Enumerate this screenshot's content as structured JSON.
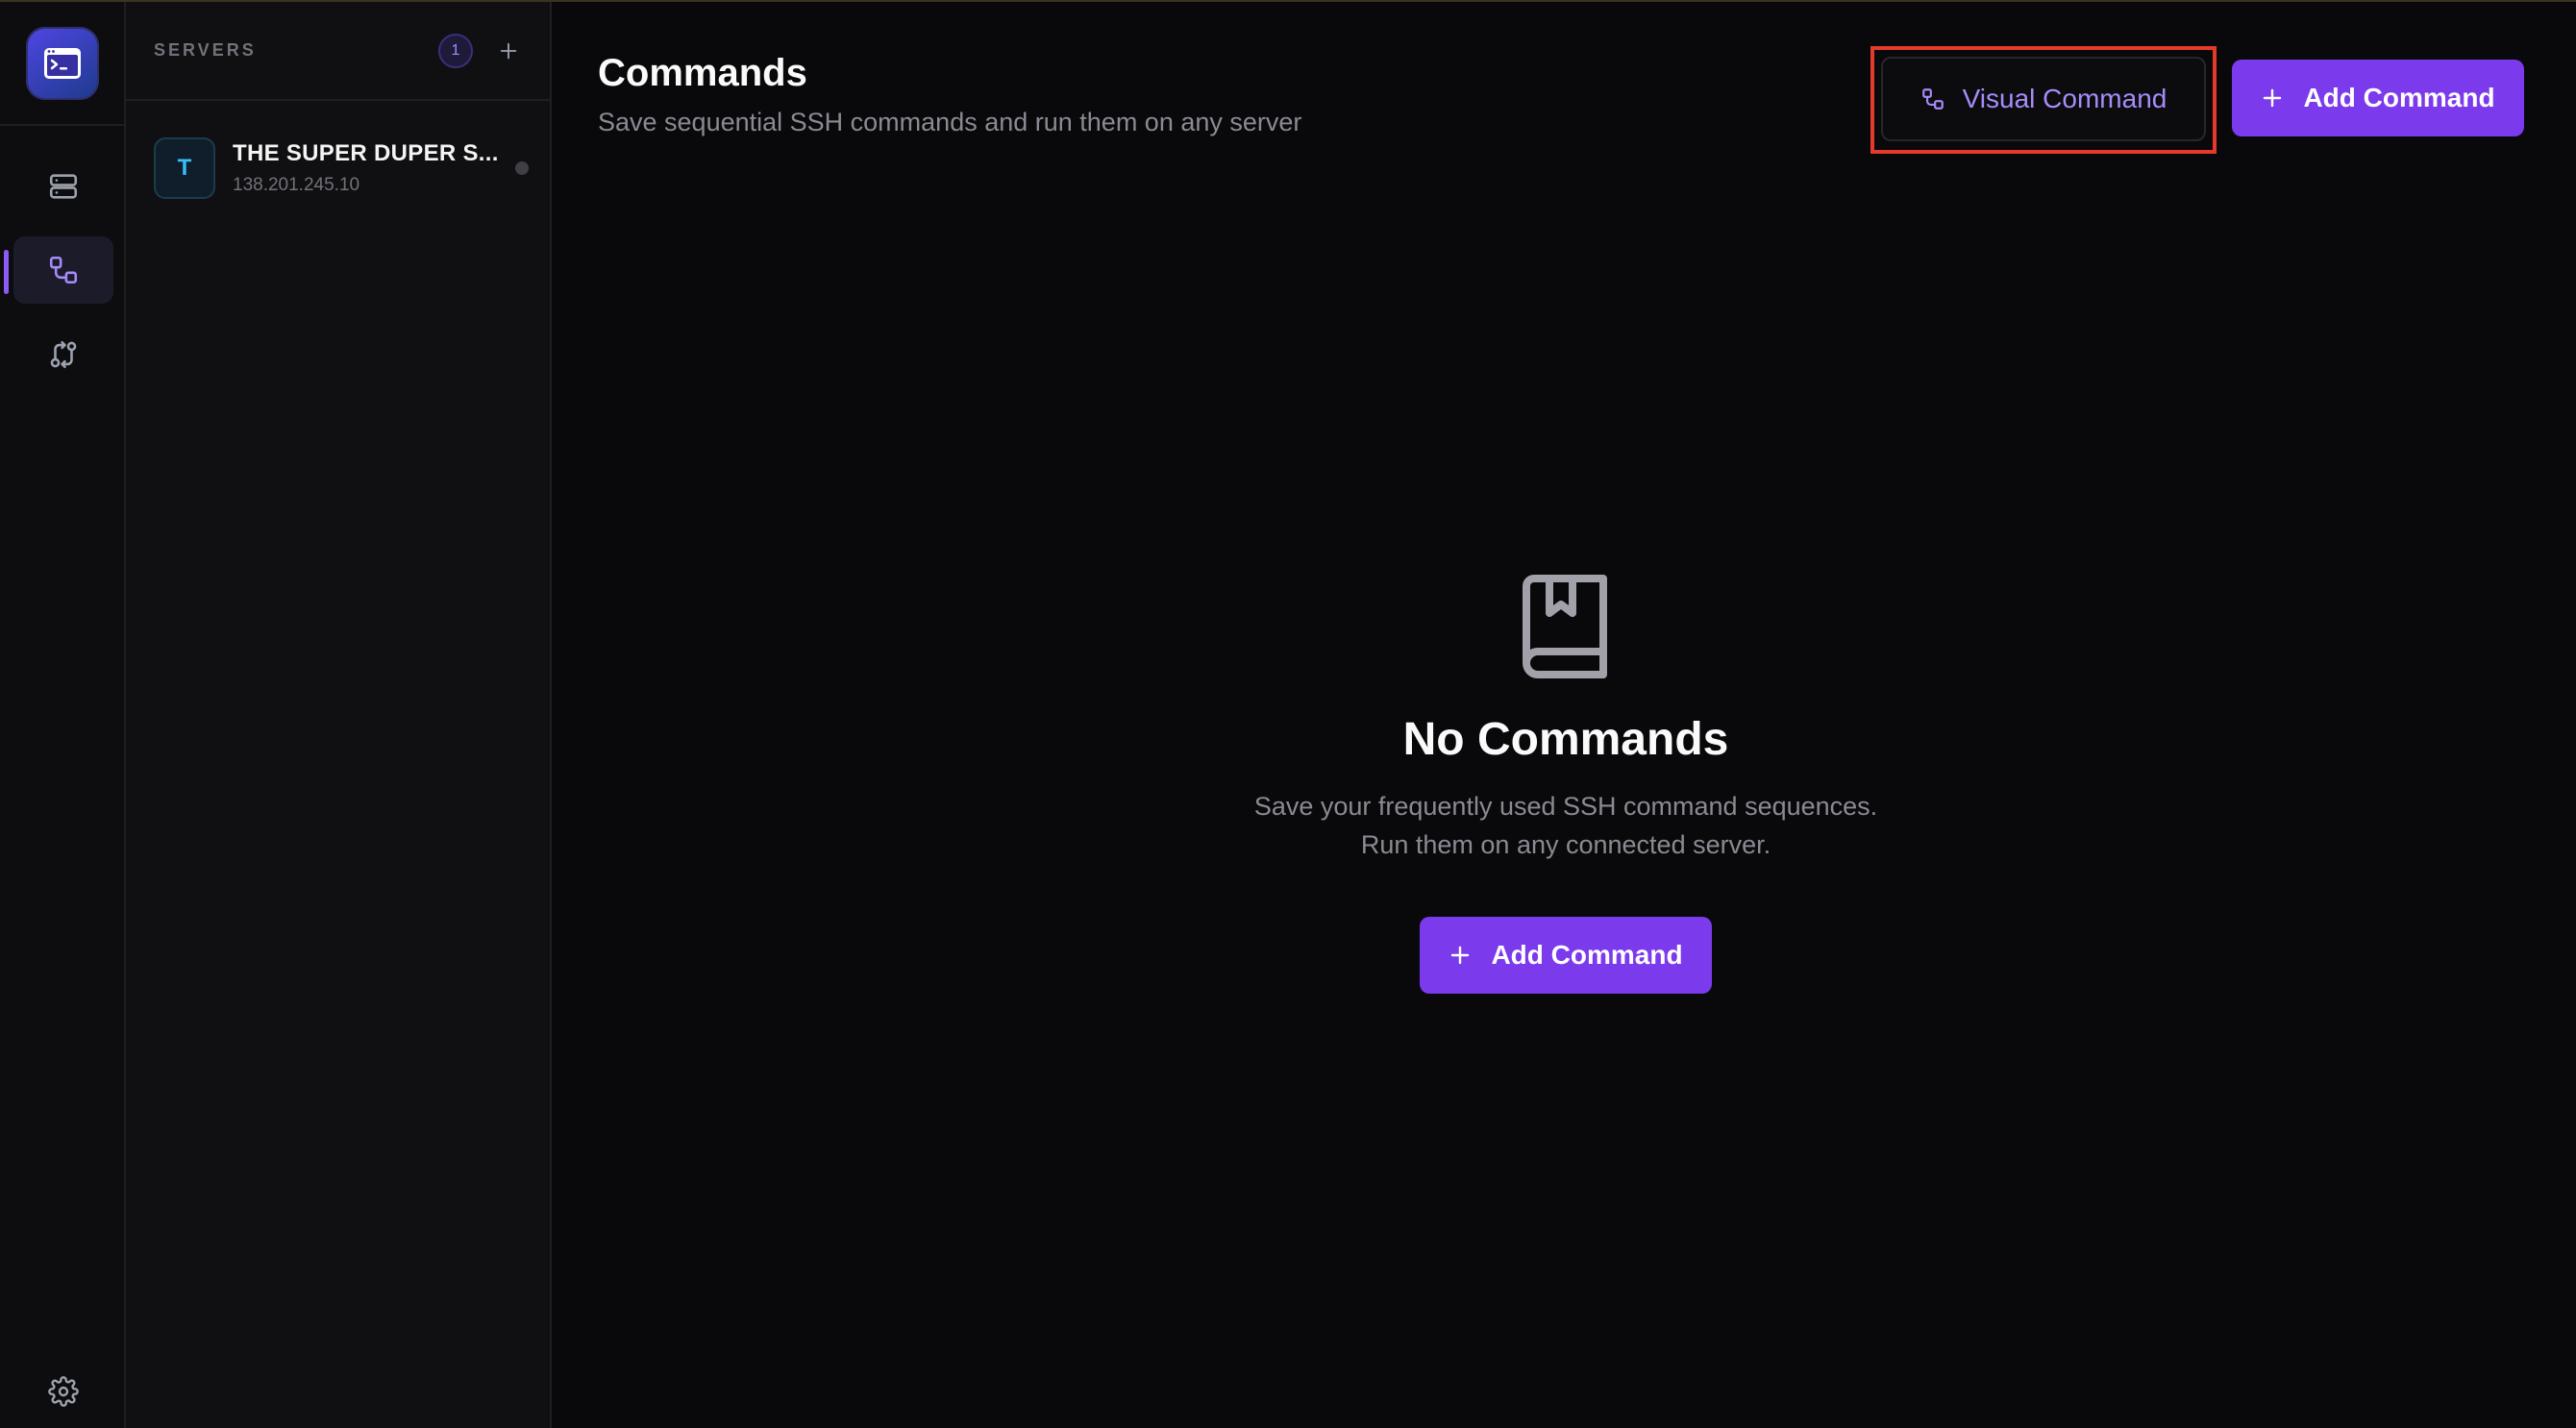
{
  "sidebar": {
    "nav": [
      {
        "icon": "servers-icon"
      },
      {
        "icon": "commands-icon",
        "active": true
      },
      {
        "icon": "transfer-icon"
      }
    ],
    "settings_icon": "gear-icon"
  },
  "servers": {
    "title": "SERVERS",
    "count": "1",
    "add_label": "+",
    "items": [
      {
        "initial": "T",
        "name": "THE SUPER DUPER S...",
        "ip": "138.201.245.10"
      }
    ]
  },
  "main": {
    "title": "Commands",
    "subtitle": "Save sequential SSH commands and run them on any server",
    "visual_command_label": "Visual Command",
    "add_command_label": "Add Command",
    "empty": {
      "title": "No Commands",
      "line1": "Save your frequently used SSH command sequences.",
      "line2": "Run them on any connected server.",
      "button_label": "Add Command"
    }
  },
  "colors": {
    "accent": "#7c3aed",
    "accent_text": "#a78bfa",
    "highlight": "#e53a2a",
    "background": "#09090b"
  }
}
